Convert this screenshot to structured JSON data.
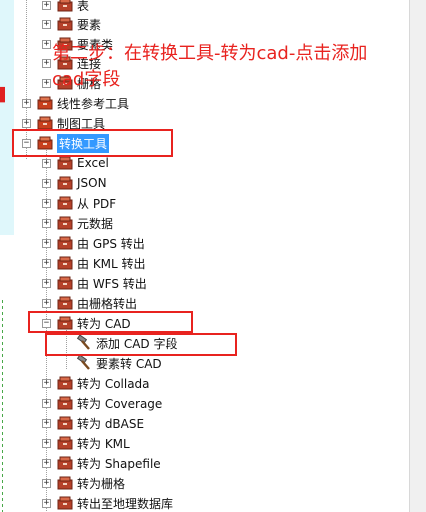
{
  "tree": {
    "top_items": [
      {
        "label": "表"
      },
      {
        "label": "要素"
      },
      {
        "label": "要素类"
      },
      {
        "label": "连接"
      },
      {
        "label": "栅格"
      }
    ],
    "linear_ref": {
      "label": "线性参考工具"
    },
    "cartography": {
      "label": "制图工具"
    },
    "conversion": {
      "label": "转换工具"
    },
    "conversion_children": [
      {
        "label": "Excel"
      },
      {
        "label": "JSON"
      },
      {
        "label": "从 PDF"
      },
      {
        "label": "元数据"
      },
      {
        "label": "由 GPS 转出"
      },
      {
        "label": "由 KML 转出"
      },
      {
        "label": "由 WFS 转出"
      },
      {
        "label": "由栅格转出"
      }
    ],
    "to_cad": {
      "label": "转为 CAD"
    },
    "to_cad_tools": [
      {
        "label": "添加 CAD 字段"
      },
      {
        "label": "要素转 CAD"
      }
    ],
    "after_cad": [
      {
        "label": "转为 Collada"
      },
      {
        "label": "转为 Coverage"
      },
      {
        "label": "转为 dBASE"
      },
      {
        "label": "转为 KML"
      },
      {
        "label": "转为 Shapefile"
      },
      {
        "label": "转为栅格"
      },
      {
        "label": "转出至地理数据库"
      }
    ],
    "expander_plus": "+",
    "expander_minus": "−"
  },
  "annotation": {
    "line1": "第二步：在转换工具-转为cad-点击添加",
    "line2": "cad字段"
  },
  "colors": {
    "annotation_red": "#e8231f",
    "selection_blue": "#3399ff",
    "toolbox_red": "#c8401e"
  }
}
